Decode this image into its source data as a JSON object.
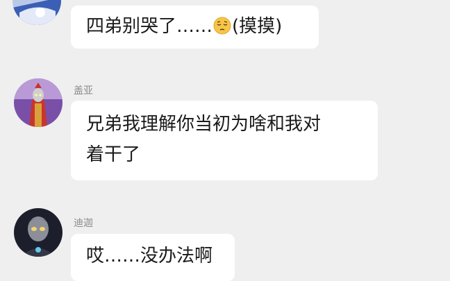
{
  "messages": [
    {
      "sender": "",
      "avatar": "blue-hero-avatar",
      "text_before": "四弟别哭了……",
      "emoji": "pensive-face-emoji",
      "text_after": "(摸摸)"
    },
    {
      "sender": "盖亚",
      "avatar": "gaia-avatar",
      "lines": [
        "兄弟我理解你当初为啥和我对",
        "着干了"
      ]
    },
    {
      "sender": "迪迦",
      "avatar": "tiga-avatar",
      "text": "哎……没办法啊"
    }
  ],
  "colors": {
    "background": "#efefef",
    "bubble": "#ffffff",
    "text": "#1a1a1a",
    "sender": "#8a8a8a"
  }
}
